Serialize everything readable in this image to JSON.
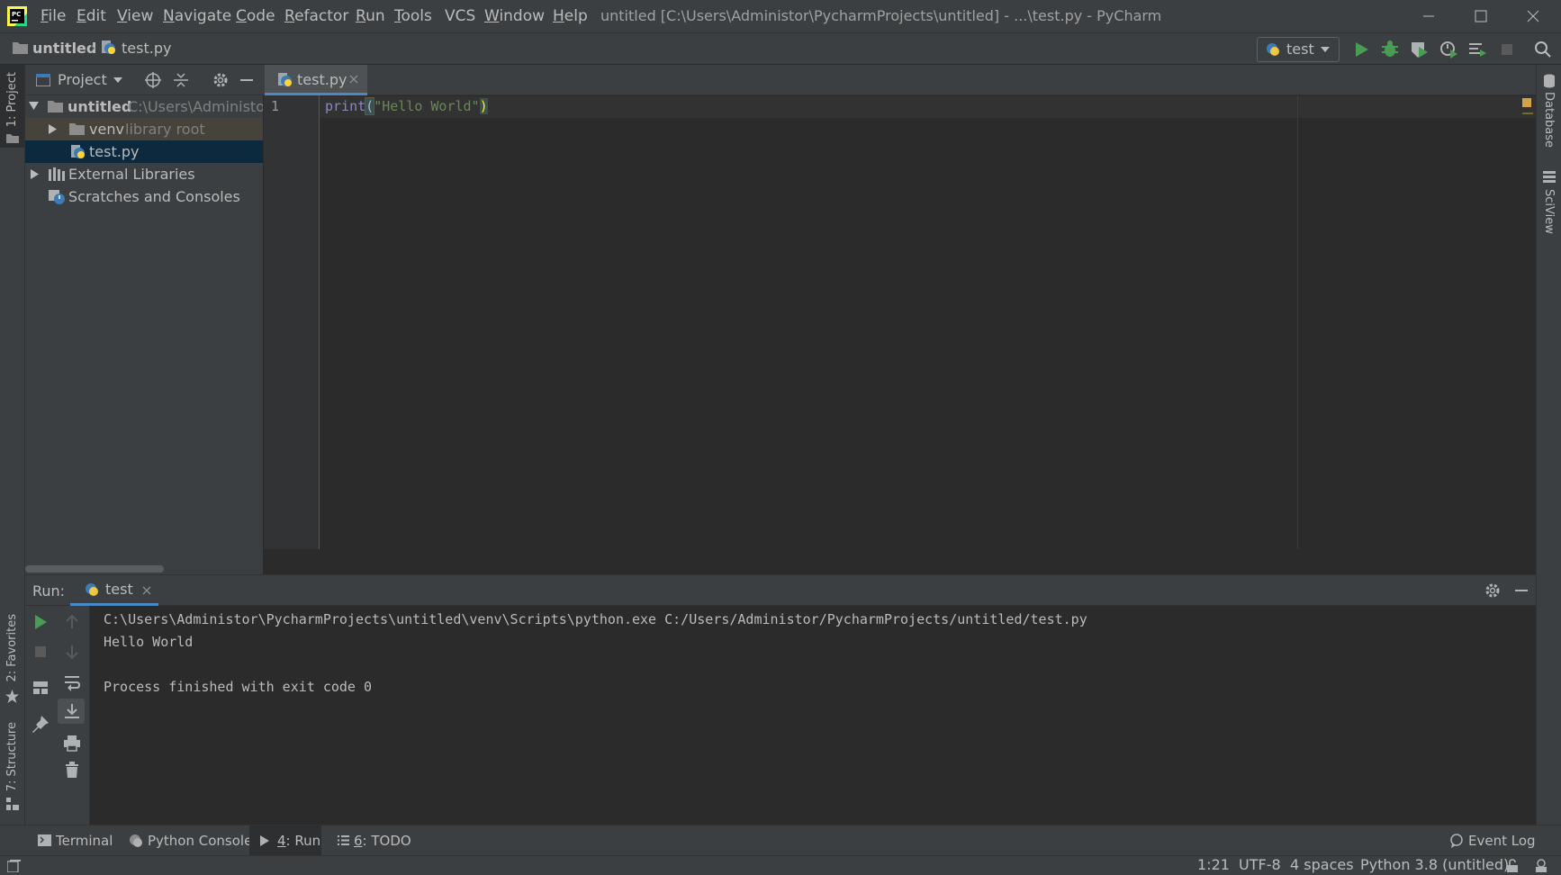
{
  "app": {
    "window_title": "untitled [C:\\Users\\Administor\\PycharmProjects\\untitled] - ...\\test.py - PyCharm",
    "menu": [
      {
        "mnemonic": "F",
        "rest": "ile"
      },
      {
        "mnemonic": "E",
        "rest": "dit"
      },
      {
        "mnemonic": "V",
        "rest": "iew"
      },
      {
        "mnemonic": "N",
        "rest": "avigate"
      },
      {
        "mnemonic": "C",
        "rest": "ode"
      },
      {
        "mnemonic": "R",
        "rest": "efactor"
      },
      {
        "mnemonic": "R",
        "rest": "un"
      },
      {
        "mnemonic": "T",
        "rest": "ools"
      },
      {
        "mnemonic": "",
        "rest": "VCS"
      },
      {
        "mnemonic": "W",
        "rest": "indow"
      },
      {
        "mnemonic": "H",
        "rest": "elp"
      }
    ]
  },
  "navbar": {
    "breadcrumb": [
      "untitled",
      "test.py"
    ],
    "run_config": "test"
  },
  "left_stripe": {
    "project_tab": "1: Project",
    "favorites_tab": "2: Favorites",
    "structure_tab": "7: Structure"
  },
  "right_stripe": {
    "database_tab": "Database",
    "sciview_tab": "SciView"
  },
  "project_panel": {
    "title": "Project",
    "tree": {
      "root_name": "untitled",
      "root_path": "C:\\Users\\Administor\\",
      "venv_name": "venv",
      "venv_hint": "library root",
      "file": "test.py",
      "external_libraries": "External Libraries",
      "scratches": "Scratches and Consoles"
    }
  },
  "editor": {
    "tab_label": "test.py",
    "line_number": "1",
    "code": {
      "fn": "print",
      "open_paren": "(",
      "string": "\"Hello World\"",
      "close_paren": ")"
    }
  },
  "run_panel": {
    "label": "Run:",
    "tab": "test",
    "console": [
      "C:\\Users\\Administor\\PycharmProjects\\untitled\\venv\\Scripts\\python.exe C:/Users/Administor/PycharmProjects/untitled/test.py",
      "Hello World",
      "",
      "Process finished with exit code 0"
    ]
  },
  "tool_windows": {
    "terminal": "Terminal",
    "python_console": "Python Console",
    "run_num": "4",
    "run_rest": ": Run",
    "todo_num": "6",
    "todo_rest": ": TODO",
    "event_log": "Event Log"
  },
  "status_bar": {
    "position": "1:21",
    "encoding": "UTF-8",
    "indent": "4 spaces",
    "interpreter": "Python 3.8 (untitled)"
  },
  "colors": {
    "accent": "#4a88c7",
    "run_green": "#499c54",
    "string_green": "#6a8759",
    "builtin_purple": "#8888c6",
    "folder": "#8c8c8c"
  }
}
